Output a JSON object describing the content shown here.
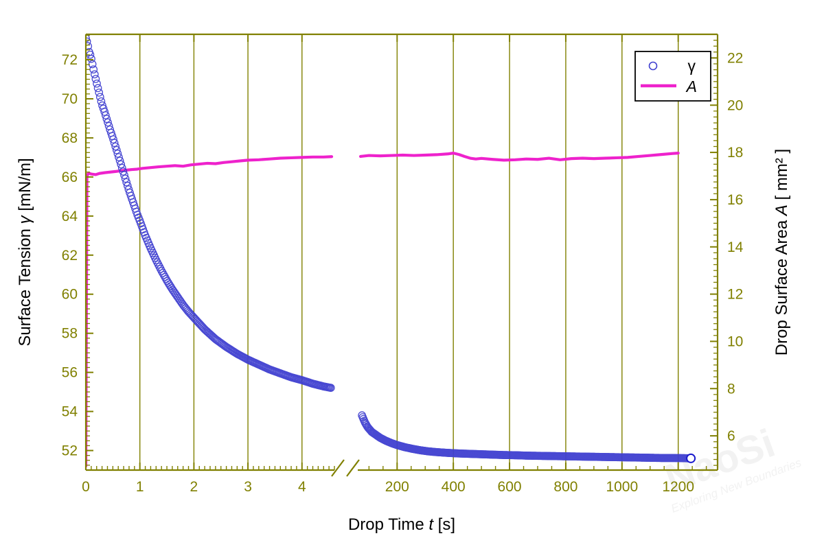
{
  "chart_data": {
    "type": "line",
    "title": "",
    "xlabel": "Drop Time  t  [s]",
    "xlabel_parts": {
      "pre": "Drop Time",
      "symbol": "t",
      "unit": "[s]"
    },
    "ylabel_left": "Surface Tension  γ  [mN/m]",
    "ylabel_left_parts": {
      "pre": "Surface Tension",
      "symbol": "γ",
      "unit": "[mN/m]"
    },
    "ylabel_right": "Drop Surface Area  A  [ mm² ]",
    "ylabel_right_parts": {
      "pre": "Drop Surface Area",
      "symbol": "A",
      "unit": "[ mm² ]"
    },
    "grid": "vertical-major-only",
    "axis_break": true,
    "axis_break_label": "//",
    "x_segments": [
      {
        "name": "early",
        "xlim": [
          0,
          4.6
        ],
        "ticks": [
          0,
          1,
          2,
          3,
          4
        ],
        "tick_labels": [
          "0",
          "1",
          "2",
          "3",
          "4"
        ],
        "minor_per_major": 10
      },
      {
        "name": "late",
        "xlim": [
          60,
          1340
        ],
        "ticks": [
          200,
          400,
          600,
          800,
          1000,
          1200
        ],
        "tick_labels": [
          "200",
          "400",
          "600",
          "800",
          "1000",
          "1200"
        ],
        "minor_per_major": 4
      }
    ],
    "ylim_left": [
      51.0,
      73.3
    ],
    "yticks_left": [
      52,
      54,
      56,
      58,
      60,
      62,
      64,
      66,
      68,
      70,
      72
    ],
    "ytick_labels_left": [
      "52",
      "54",
      "56",
      "58",
      "60",
      "62",
      "64",
      "66",
      "68",
      "70",
      "72"
    ],
    "ylim_right": [
      4.55,
      23.0
    ],
    "yticks_right": [
      6,
      8,
      10,
      12,
      14,
      16,
      18,
      20,
      22
    ],
    "ytick_labels_right": [
      "6",
      "8",
      "10",
      "12",
      "14",
      "16",
      "18",
      "20",
      "22"
    ],
    "colors": {
      "axis": "#808000",
      "grid": "#808000",
      "gamma": "#4040d0",
      "area": "#ee22cc",
      "title": "#000000",
      "background": "#ffffff"
    },
    "legend": {
      "position": "top-right",
      "entries": [
        {
          "label": "γ",
          "marker": "open-circle",
          "color": "#4040d0",
          "series": "gamma"
        },
        {
          "label": "A",
          "marker": "line",
          "color": "#ee22cc",
          "series": "area",
          "italic": true
        }
      ]
    },
    "series": [
      {
        "name": "gamma",
        "label": "γ",
        "axis": "left",
        "style": "open-circle-markers",
        "color": "#4040d0",
        "unit": "mN/m",
        "segment_early": {
          "x": [
            0.0,
            0.03,
            0.06,
            0.09,
            0.12,
            0.15,
            0.18,
            0.21,
            0.25,
            0.3,
            0.35,
            0.4,
            0.45,
            0.5,
            0.55,
            0.6,
            0.65,
            0.7,
            0.75,
            0.8,
            0.85,
            0.9,
            0.95,
            1.0,
            1.1,
            1.2,
            1.3,
            1.4,
            1.5,
            1.6,
            1.7,
            1.8,
            1.9,
            2.0,
            2.2,
            2.4,
            2.6,
            2.8,
            3.0,
            3.2,
            3.4,
            3.6,
            3.8,
            4.0,
            4.2,
            4.4,
            4.55
          ],
          "y": [
            73.1,
            72.85,
            72.4,
            72.2,
            71.8,
            71.4,
            71.05,
            70.7,
            70.25,
            69.7,
            69.3,
            68.85,
            68.4,
            68.0,
            67.55,
            67.1,
            66.65,
            66.2,
            65.75,
            65.3,
            64.9,
            64.5,
            64.1,
            63.75,
            63.0,
            62.35,
            61.75,
            61.2,
            60.7,
            60.25,
            59.85,
            59.45,
            59.1,
            58.8,
            58.2,
            57.7,
            57.3,
            56.95,
            56.65,
            56.4,
            56.15,
            55.95,
            55.75,
            55.6,
            55.42,
            55.28,
            55.2
          ]
        },
        "segment_late": {
          "x": [
            75,
            85,
            95,
            110,
            125,
            140,
            160,
            180,
            200,
            225,
            250,
            280,
            310,
            340,
            380,
            420,
            460,
            500,
            540,
            580,
            620,
            660,
            700,
            740,
            780,
            820,
            860,
            900,
            940,
            980,
            1020,
            1060,
            1100,
            1140,
            1180,
            1220,
            1245
          ],
          "y": [
            53.8,
            53.45,
            53.2,
            52.95,
            52.8,
            52.65,
            52.5,
            52.38,
            52.28,
            52.18,
            52.1,
            52.02,
            51.96,
            51.92,
            51.88,
            51.85,
            51.83,
            51.81,
            51.79,
            51.77,
            51.76,
            51.74,
            51.73,
            51.72,
            51.71,
            51.7,
            51.69,
            51.68,
            51.67,
            51.66,
            51.65,
            51.64,
            51.63,
            51.62,
            51.62,
            51.61,
            51.6
          ]
        },
        "range_start": 73.1,
        "range_end": 51.6
      },
      {
        "name": "area",
        "label": "A",
        "axis": "right",
        "style": "solid-line",
        "color": "#ee22cc",
        "unit": "mm²",
        "segment_early": {
          "x": [
            0.0,
            0.02,
            0.05,
            0.1,
            0.18,
            0.25,
            0.35,
            0.45,
            0.55,
            0.65,
            0.75,
            0.85,
            0.95,
            1.05,
            1.2,
            1.35,
            1.5,
            1.65,
            1.8,
            1.95,
            2.1,
            2.25,
            2.4,
            2.55,
            2.7,
            2.85,
            3.0,
            3.2,
            3.4,
            3.6,
            3.8,
            4.0,
            4.2,
            4.4,
            4.55
          ],
          "y_left_scale": [
            51.2,
            66.05,
            66.2,
            66.15,
            66.12,
            66.18,
            66.22,
            66.25,
            66.28,
            66.32,
            66.35,
            66.38,
            66.4,
            66.44,
            66.48,
            66.52,
            66.55,
            66.58,
            66.55,
            66.62,
            66.66,
            66.7,
            66.68,
            66.74,
            66.78,
            66.82,
            66.86,
            66.88,
            66.92,
            66.96,
            66.98,
            67.0,
            67.02,
            67.02,
            67.04
          ]
        },
        "segment_late": {
          "x": [
            70,
            100,
            140,
            180,
            220,
            260,
            300,
            340,
            380,
            400,
            420,
            440,
            460,
            480,
            500,
            540,
            580,
            620,
            660,
            700,
            740,
            780,
            820,
            860,
            900,
            940,
            980,
            1020,
            1060,
            1100,
            1140,
            1180,
            1200
          ],
          "y_left_scale": [
            67.05,
            67.1,
            67.08,
            67.1,
            67.12,
            67.1,
            67.12,
            67.14,
            67.18,
            67.22,
            67.15,
            67.05,
            66.96,
            66.92,
            66.95,
            66.9,
            66.86,
            66.88,
            66.92,
            66.9,
            66.96,
            66.88,
            66.94,
            66.96,
            66.94,
            66.96,
            66.98,
            67.0,
            67.05,
            67.1,
            67.15,
            67.2,
            67.22
          ]
        },
        "plateau_value_mm2": 17.9
      }
    ]
  },
  "watermark": {
    "main": "NaoSi",
    "sub": "Exploring New Boundaries"
  }
}
